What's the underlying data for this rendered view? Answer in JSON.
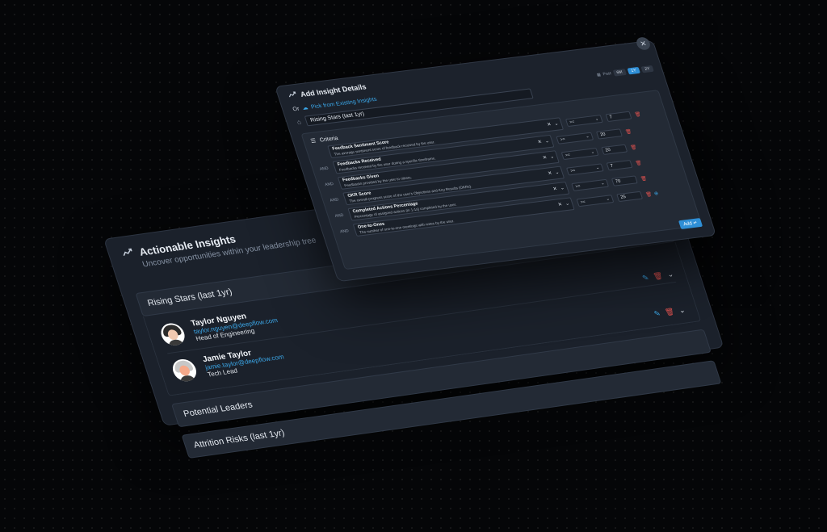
{
  "insights": {
    "title": "Actionable Insights",
    "subtitle": "Uncover opportunities within your leadership tree",
    "groups": [
      {
        "label": "Rising Stars (last 1yr)",
        "people": [
          {
            "name": "Taylor Nguyen",
            "email": "taylor.nguyen@deepflow.com",
            "role": "Head of Engineering"
          },
          {
            "name": "Jamie Taylor",
            "email": "jamie.taylor@deepflow.com",
            "role": "Tech Lead"
          }
        ]
      },
      {
        "label": "Potential Leaders"
      },
      {
        "label": "Attrition Risks (last 1yr)"
      }
    ]
  },
  "modal": {
    "title": "Add Insight Details",
    "pick_prefix": "Or",
    "pick_link": "Pick from Existing Insights",
    "range_label": "Past",
    "ranges": [
      "6M",
      "1Y",
      "2Y"
    ],
    "active_range": "1Y",
    "insight_name": "Rising Stars (last 1yr)",
    "criteria_label": "Criteria",
    "and_label": "AND",
    "add_label": "Add",
    "criteria": [
      {
        "name": "Feedback Sentiment Score",
        "desc": "The average sentiment score of feedback received by the user.",
        "op": ">=",
        "value": "7"
      },
      {
        "name": "Feedbacks Received",
        "desc": "Feedbacks received by the user during a specific timeframe.",
        "op": ">=",
        "value": "20"
      },
      {
        "name": "Feedbacks Given",
        "desc": "Feedbacks provided by the user to others.",
        "op": ">=",
        "value": "20"
      },
      {
        "name": "OKR Score",
        "desc": "The overall progress score of the user's Objectives and Key Results (OKRs).",
        "op": ">=",
        "value": "7"
      },
      {
        "name": "Completed Actions Percentage",
        "desc": "Percentage of assigned actions (in 1-1s) completed by the user.",
        "op": ">=",
        "value": "70"
      },
      {
        "name": "One-to-Ones",
        "desc": "The number of one-to-one meetings with notes by the user.",
        "op": ">=",
        "value": "25"
      }
    ]
  },
  "colors": {
    "accent": "#2f8fd6",
    "link": "#3ba7e8",
    "danger": "#e0524f",
    "panel": "#1c222c"
  }
}
